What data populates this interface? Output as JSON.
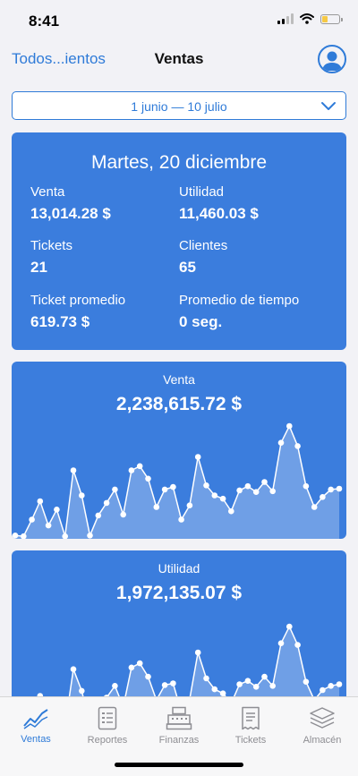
{
  "status": {
    "time": "8:41",
    "battery_color": "#f6c945",
    "battery_level": 0.35
  },
  "nav": {
    "back_label": "Todos...ientos",
    "title": "Ventas",
    "avatar_icon": "person-circle-icon"
  },
  "range": {
    "value": "1 junio — 10 julio",
    "icon": "chevron-down-icon"
  },
  "summary": {
    "date": "Martes, 20 diciembre",
    "metrics": [
      {
        "label": "Venta",
        "value": "13,014.28 $"
      },
      {
        "label": "Utilidad",
        "value": "11,460.03 $"
      },
      {
        "label": "Tickets",
        "value": "21"
      },
      {
        "label": "Clientes",
        "value": "65"
      },
      {
        "label": "Ticket promedio",
        "value": "619.73 $"
      },
      {
        "label": "Promedio de tiempo",
        "value": "0 seg."
      }
    ]
  },
  "colors": {
    "accent": "#2f7bd8",
    "card": "#3b7ddd",
    "area_fill": "#6f9fe6",
    "tab_inactive": "#8e8e93"
  },
  "chart_data": [
    {
      "type": "area",
      "title": "Venta",
      "total": "2,238,615.72 $",
      "x": [
        0,
        1,
        2,
        3,
        4,
        5,
        6,
        7,
        8,
        9,
        10,
        11,
        12,
        13,
        14,
        15,
        16,
        17,
        18,
        19,
        20,
        21,
        22,
        23,
        24,
        25,
        26,
        27,
        28,
        29,
        30,
        31,
        32,
        33,
        34,
        35,
        36,
        37,
        38,
        39
      ],
      "values": [
        0.04,
        0.03,
        0.23,
        0.45,
        0.16,
        0.35,
        0.03,
        0.82,
        0.52,
        0.04,
        0.28,
        0.43,
        0.59,
        0.29,
        0.82,
        0.87,
        0.72,
        0.38,
        0.59,
        0.62,
        0.23,
        0.4,
        0.98,
        0.64,
        0.52,
        0.48,
        0.33,
        0.58,
        0.63,
        0.56,
        0.68,
        0.57,
        1.15,
        1.35,
        1.11,
        0.63,
        0.38,
        0.5,
        0.59,
        0.6
      ],
      "ylim": [
        0,
        1.5
      ]
    },
    {
      "type": "area",
      "title": "Utilidad",
      "total": "1,972,135.07 $",
      "x": [
        0,
        1,
        2,
        3,
        4,
        5,
        6,
        7,
        8,
        9,
        10,
        11,
        12,
        13,
        14,
        15,
        16,
        17,
        18,
        19,
        20,
        21,
        22,
        23,
        24,
        25,
        26,
        27,
        28,
        29,
        30,
        31,
        32,
        33,
        34,
        35,
        36,
        37,
        38,
        39
      ],
      "values": [
        0.03,
        0.02,
        0.19,
        0.38,
        0.13,
        0.3,
        0.02,
        0.7,
        0.44,
        0.03,
        0.24,
        0.36,
        0.5,
        0.25,
        0.72,
        0.77,
        0.61,
        0.33,
        0.51,
        0.53,
        0.19,
        0.34,
        0.9,
        0.59,
        0.46,
        0.41,
        0.29,
        0.52,
        0.56,
        0.49,
        0.61,
        0.5,
        1.01,
        1.21,
        0.99,
        0.55,
        0.33,
        0.45,
        0.5,
        0.52
      ],
      "ylim": [
        0,
        1.5
      ]
    }
  ],
  "tabs": [
    {
      "label": "Ventas",
      "icon": "sales-chart-icon",
      "active": true
    },
    {
      "label": "Reportes",
      "icon": "report-document-icon",
      "active": false
    },
    {
      "label": "Finanzas",
      "icon": "cash-register-icon",
      "active": false
    },
    {
      "label": "Tickets",
      "icon": "ticket-receipt-icon",
      "active": false
    },
    {
      "label": "Almacén",
      "icon": "warehouse-layers-icon",
      "active": false
    }
  ]
}
